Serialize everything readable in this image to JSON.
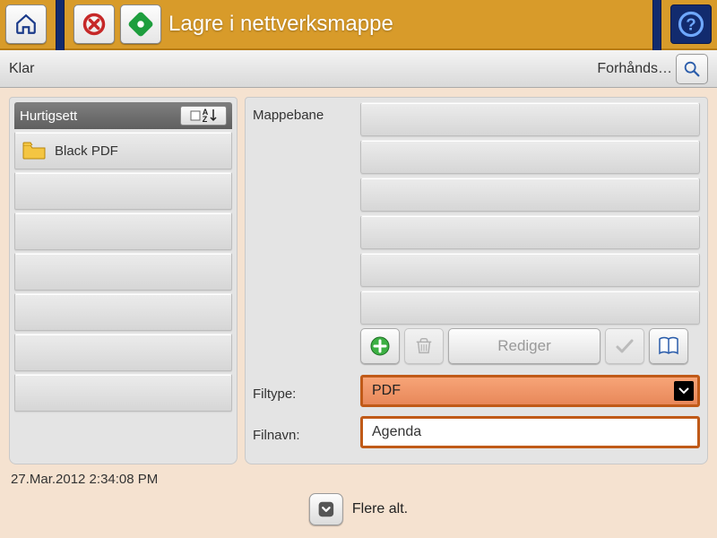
{
  "title": "Lagre i nettverksmappe",
  "status": "Klar",
  "preview_label": "Forhånds…",
  "quicksets": {
    "header": "Hurtigsett",
    "items": [
      "Black PDF",
      "",
      "",
      "",
      "",
      "",
      ""
    ]
  },
  "folderpath": {
    "label": "Mappebane",
    "rows": 6,
    "edit_label": "Rediger"
  },
  "filetype": {
    "label": "Filtype:",
    "value": "PDF"
  },
  "filename": {
    "label": "Filnavn:",
    "value": "Agenda"
  },
  "timestamp": "27.Mar.2012 2:34:08 PM",
  "more_label": "Flere alt."
}
